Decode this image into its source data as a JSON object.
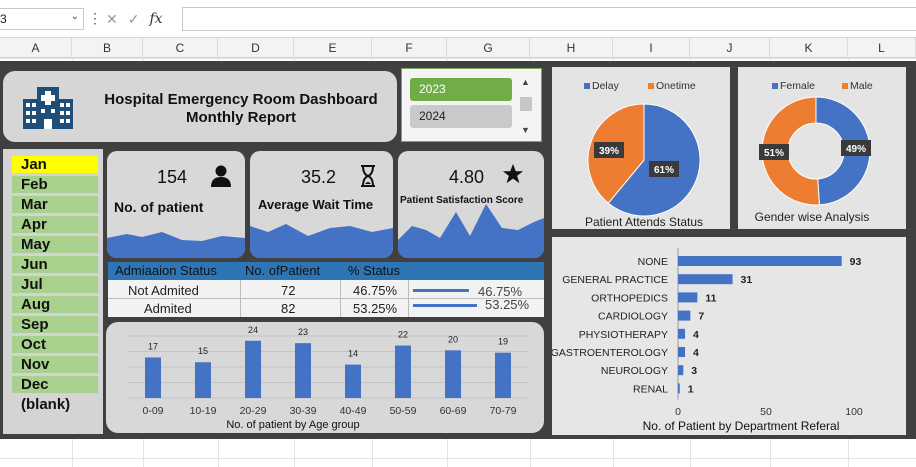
{
  "excel": {
    "name_box": "3",
    "columns": [
      "A",
      "B",
      "C",
      "D",
      "E",
      "F",
      "G",
      "H",
      "I",
      "J",
      "K",
      "L"
    ]
  },
  "dashboard": {
    "title_line1": "Hospital Emergency Room Dashboard",
    "title_line2": "Monthly Report",
    "year_slicer": {
      "items": [
        "2023",
        "2024"
      ],
      "selected": "2023"
    },
    "month_slicer": {
      "items": [
        "Jan",
        "Feb",
        "Mar",
        "Apr",
        "May",
        "Jun",
        "Jul",
        "Aug",
        "Sep",
        "Oct",
        "Nov",
        "Dec",
        "(blank)"
      ],
      "selected": "Jan"
    },
    "kpis": [
      {
        "value": "154",
        "label": "No. of patient",
        "icon": "person-icon"
      },
      {
        "value": "35.2",
        "label": "Average Wait Time",
        "icon": "hourglass-icon"
      },
      {
        "value": "4.80",
        "label": "Patient Satisfaction Score",
        "icon": "star-icon"
      }
    ],
    "admission_table": {
      "headers": [
        "Admiaaion Status",
        "No. ofPatient",
        "% Status"
      ],
      "rows": [
        {
          "status": "Not Admited",
          "count": "72",
          "pct": "46.75%",
          "bar_label": "46.75%",
          "bar_fraction": 0.4675
        },
        {
          "status": "Admited",
          "count": "82",
          "pct": "53.25%",
          "bar_label": "53.25%",
          "bar_fraction": 0.5325
        }
      ]
    },
    "colors": {
      "blue": "#4472c4",
      "orange": "#ed7d31",
      "slicer_green": "#a9d18e",
      "year_green": "#70ad47",
      "header_blue": "#2e75b6"
    }
  },
  "chart_data": [
    {
      "type": "bar",
      "title": "No. of patient by Age group",
      "categories": [
        "0-09",
        "10-19",
        "20-29",
        "30-39",
        "40-49",
        "50-59",
        "60-69",
        "70-79"
      ],
      "values": [
        17,
        15,
        24,
        23,
        14,
        22,
        20,
        19
      ],
      "ylim": [
        0,
        26
      ],
      "grid": true
    },
    {
      "type": "pie",
      "title": "Patient Attends Status",
      "legend": [
        "Delay",
        "Onetime"
      ],
      "legend_position": "top",
      "values": [
        61,
        39
      ],
      "labels": [
        "61%",
        "39%"
      ],
      "colors": [
        "#4472c4",
        "#ed7d31"
      ]
    },
    {
      "type": "pie",
      "title": "Gender wise Analysis",
      "legend": [
        "Female",
        "Male"
      ],
      "legend_position": "top",
      "values": [
        49,
        51
      ],
      "labels": [
        "49%",
        "51%"
      ],
      "colors": [
        "#4472c4",
        "#ed7d31"
      ],
      "donut": true
    },
    {
      "type": "bar",
      "orientation": "horizontal",
      "title": "No. of Patient by Department Referal",
      "categories": [
        "NONE",
        "GENERAL PRACTICE",
        "ORTHOPEDICS",
        "CARDIOLOGY",
        "PHYSIOTHERAPY",
        "GASTROENTEROLOGY",
        "NEUROLOGY",
        "RENAL"
      ],
      "values": [
        93,
        31,
        11,
        7,
        4,
        4,
        3,
        1
      ],
      "xlim": [
        0,
        100
      ],
      "xticks": [
        "0",
        "50",
        "100"
      ]
    }
  ]
}
